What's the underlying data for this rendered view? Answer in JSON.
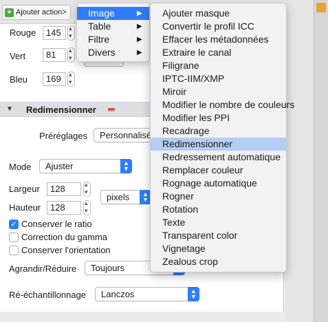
{
  "toolbar": {
    "add_action_label": "Ajouter action>"
  },
  "colors": {
    "rouge": {
      "label": "Rouge",
      "value": "145"
    },
    "vert": {
      "label": "Vert",
      "value": "81"
    },
    "bleu": {
      "label": "Bleu",
      "value": "169"
    }
  },
  "section": {
    "title": "Redimensionner"
  },
  "presets": {
    "label": "Préréglages",
    "value": "Personnalisé"
  },
  "mode": {
    "label": "Mode",
    "value": "Ajuster"
  },
  "size": {
    "width_label": "Largeur",
    "width_value": "128",
    "height_label": "Hauteur",
    "height_value": "128",
    "unit": "pixels"
  },
  "options": {
    "keep_ratio": {
      "label": "Conserver le ratio",
      "checked": true
    },
    "gamma": {
      "label": "Correction du gamma",
      "checked": false
    },
    "orientation": {
      "label": "Conserver l'orientation",
      "checked": false
    }
  },
  "enlarge": {
    "label": "Agrandir/Réduire",
    "value": "Toujours"
  },
  "resample": {
    "label": "Ré-échantillonnage",
    "value": "Lanczos"
  },
  "main_menu": {
    "items": [
      "Image",
      "Table",
      "Filtre",
      "Divers"
    ],
    "selected": "Image"
  },
  "submenu": {
    "items": [
      "Ajouter masque",
      "Convertir le profil ICC",
      "Effacer les métadonnées",
      "Extraire le canal",
      "Filigrane",
      "IPTC-IIM/XMP",
      "Miroir",
      "Modifier le nombre de couleurs",
      "Modifier les PPI",
      "Recadrage",
      "Redimensionner",
      "Redressement automatique",
      "Remplacer couleur",
      "Rognage automatique",
      "Rogner",
      "Rotation",
      "Texte",
      "Transparent color",
      "Vignetage",
      "Zealous crop"
    ],
    "selected": "Redimensionner"
  },
  "accent": "#2f7df6"
}
